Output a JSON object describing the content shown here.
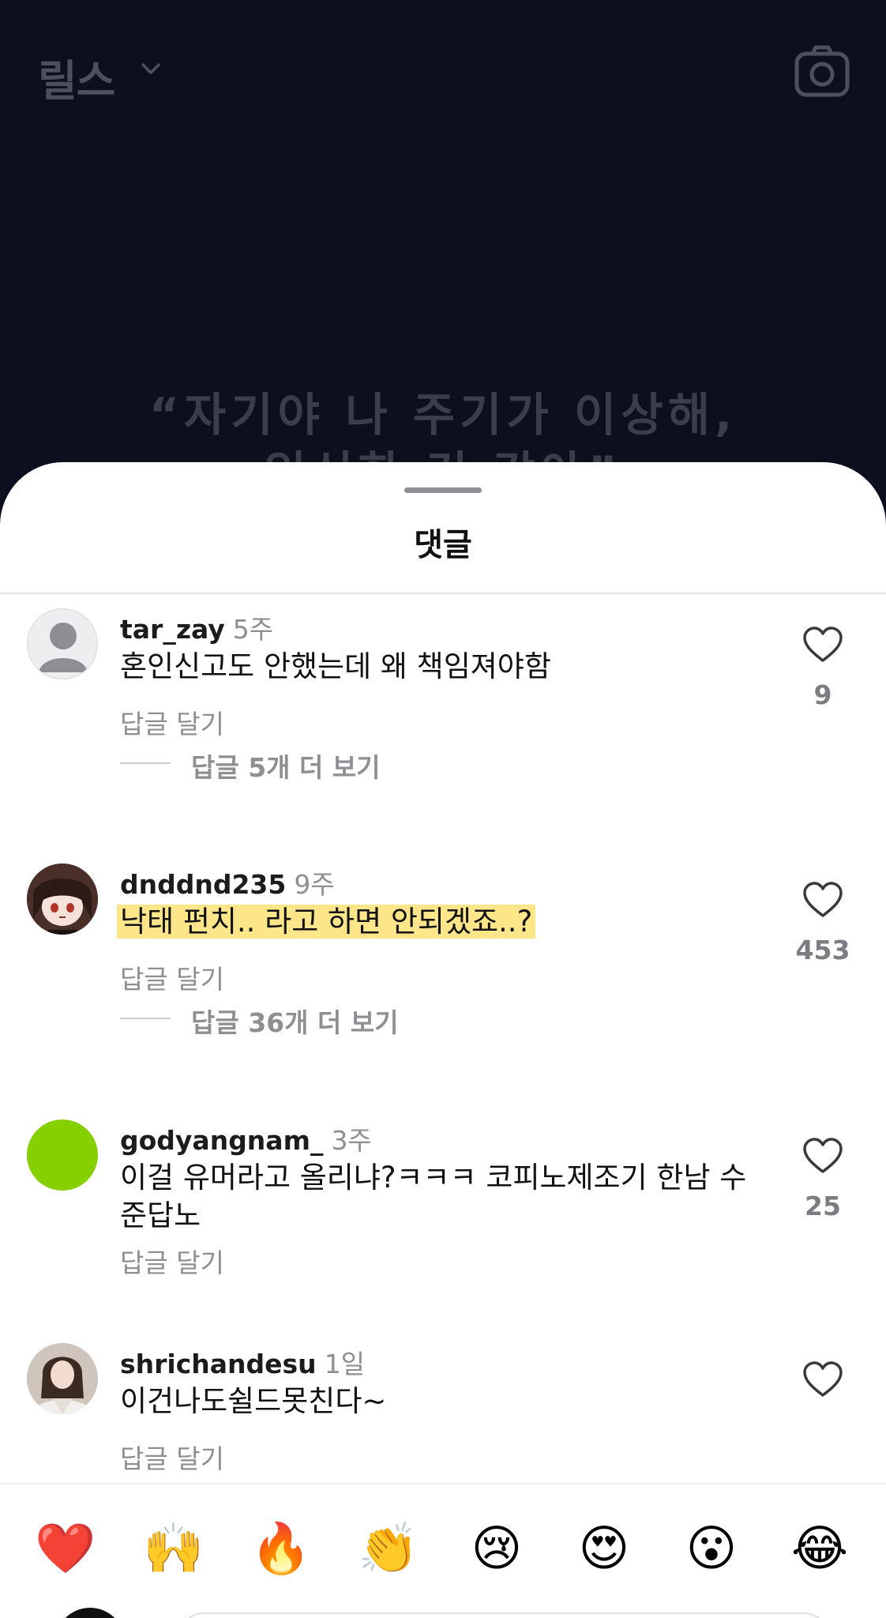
{
  "header": {
    "title": "릴스",
    "chevron_icon": "chevron-down-icon",
    "camera_icon": "camera-icon"
  },
  "reel_caption": {
    "line1": "“자기야 나 주기가 이상해,",
    "line2": "임신한 것 같아”"
  },
  "sheet": {
    "title": "댓글"
  },
  "comments": [
    {
      "username": "tar_zay",
      "time": "5주",
      "text": "혼인신고도 안했는데 왜 책임져야함",
      "reply_label": "답글 달기",
      "likes": "9",
      "view_more": "답글 5개 더 보기",
      "avatar": "default-avatar"
    },
    {
      "username": "dnddnd235",
      "time": "9주",
      "text": "낙태 펀치.. 라고 하면 안되겠죠..?",
      "reply_label": "답글 달기",
      "likes": "453",
      "view_more": "답글 36개 더 보기",
      "avatar": "anime-avatar"
    },
    {
      "username": "godyangnam_",
      "time": "3주",
      "text": "이걸 유머라고 올리냐?ㅋㅋㅋ 코피노제조기 한남 수준답노",
      "reply_label": "답글 달기",
      "likes": "25",
      "avatar": "green-avatar"
    },
    {
      "username": "shrichandesu",
      "time": "1일",
      "text": "이건나도쉴드못친다~",
      "reply_label": "답글 달기",
      "likes": "",
      "avatar": "photo-avatar"
    }
  ],
  "emoji_bar": [
    {
      "emoji": "❤️",
      "name": "red-heart-emoji"
    },
    {
      "emoji": "🙌",
      "name": "raising-hands-emoji"
    },
    {
      "emoji": "🔥",
      "name": "fire-emoji"
    },
    {
      "emoji": "👏",
      "name": "clapping-hands-emoji"
    },
    {
      "emoji": "😢",
      "name": "crying-face-emoji"
    },
    {
      "emoji": "😍",
      "name": "heart-eyes-emoji"
    },
    {
      "emoji": "😮",
      "name": "surprised-face-emoji"
    },
    {
      "emoji": "😂",
      "name": "tears-of-joy-emoji"
    }
  ],
  "colors": {
    "background_dark": "#0c0f1e",
    "highlight": "#fde58a",
    "muted_text": "#8e8e93",
    "green_avatar": "#86d000"
  }
}
